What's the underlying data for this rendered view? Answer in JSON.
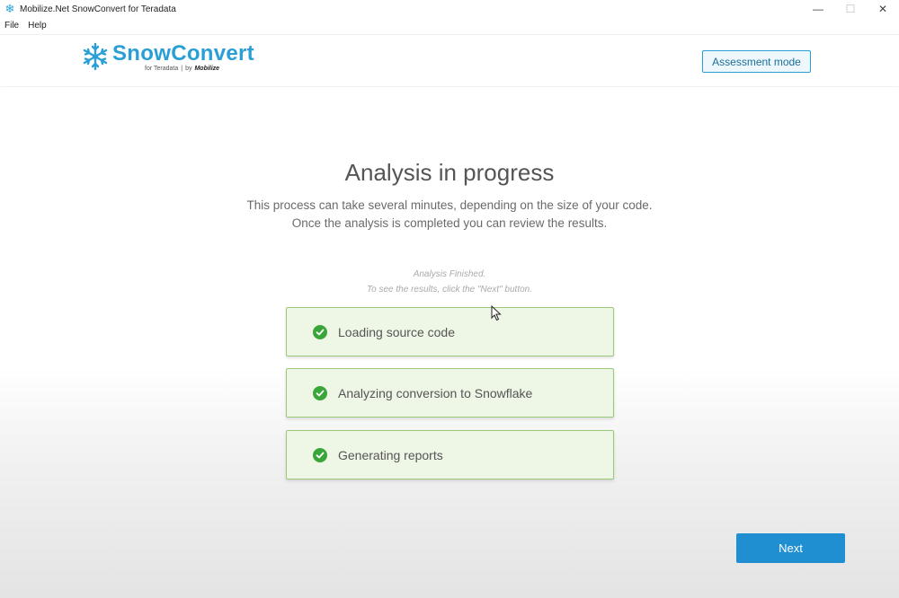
{
  "window": {
    "title": "Mobilize.Net SnowConvert for Teradata",
    "controls": {
      "minimize": "—",
      "maximize": "☐",
      "close": "✕"
    }
  },
  "menu": [
    "File",
    "Help"
  ],
  "header": {
    "logo_name": "SnowConvert",
    "logo_sub_left": "for Teradata",
    "logo_sub_sep": "|",
    "logo_sub_by": "by",
    "logo_brand": "Mobilize",
    "mode_button": "Assessment mode"
  },
  "main": {
    "heading": "Analysis in progress",
    "description_line1": "This process can take several minutes, depending on the size of your code.",
    "description_line2": "Once the analysis is completed you can review the results.",
    "status_line1": "Analysis Finished.",
    "status_line2": "To see the results, click the \"Next\" button.",
    "steps": [
      {
        "label": "Loading source code",
        "state": "done"
      },
      {
        "label": "Analyzing conversion to Snowflake",
        "state": "done"
      },
      {
        "label": "Generating reports",
        "state": "done"
      }
    ],
    "next_button": "Next"
  },
  "colors": {
    "accent": "#2a9fd6",
    "next_button": "#1f8fd1",
    "step_background": "#eef6e6",
    "step_border": "#9cc87a",
    "check": "#3aa63a"
  },
  "icons": {
    "app": "snowflake-icon",
    "logo": "snowflake-logo-icon",
    "check": "check-circle-icon"
  }
}
